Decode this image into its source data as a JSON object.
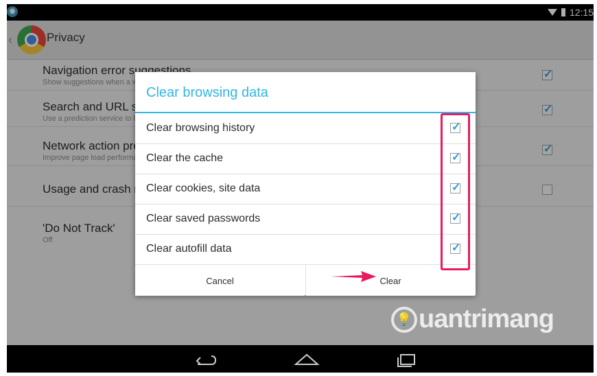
{
  "status_bar": {
    "time": "12:15"
  },
  "action_bar": {
    "title": "Privacy"
  },
  "settings": [
    {
      "title": "Navigation error suggestions",
      "summary": "Show suggestions when a web address does not resolve or a connection cannot be made",
      "checked": true
    },
    {
      "title": "Search and URL suggestions",
      "summary": "Use a prediction service to help complete searches and URLs typed in the address bar",
      "checked": true
    },
    {
      "title": "Network action predictions",
      "summary": "Improve page load performance",
      "checked": true
    },
    {
      "title": "Usage and crash reports",
      "summary": "",
      "checked": false
    },
    {
      "title": "'Do Not Track'",
      "summary": "Off",
      "checked": null
    }
  ],
  "dialog": {
    "title": "Clear browsing data",
    "options": [
      {
        "label": "Clear browsing history",
        "checked": true
      },
      {
        "label": "Clear the cache",
        "checked": true
      },
      {
        "label": "Clear cookies, site data",
        "checked": true
      },
      {
        "label": "Clear saved passwords",
        "checked": true
      },
      {
        "label": "Clear autofill data",
        "checked": true
      }
    ],
    "cancel_label": "Cancel",
    "clear_label": "Clear"
  },
  "annotation_color": "#e8195f",
  "accent_color": "#33b5e5",
  "watermark": "uantrimang",
  "icons": {
    "status_app": "app-notification-icon",
    "wifi": "wifi-icon",
    "battery": "battery-icon",
    "chrome": "chrome-logo-icon",
    "nav_back": "back-icon",
    "nav_home": "home-icon",
    "nav_recent": "recent-apps-icon"
  }
}
